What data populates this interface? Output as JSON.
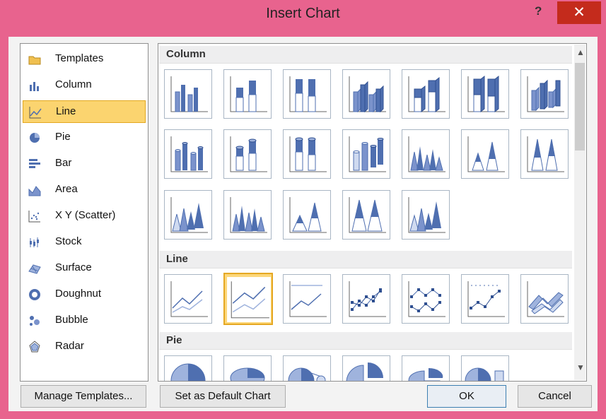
{
  "window": {
    "title": "Insert Chart",
    "help": "?",
    "close": "✕"
  },
  "categories": [
    {
      "label": "Templates",
      "icon": "folder-icon"
    },
    {
      "label": "Column",
      "icon": "column-chart-icon"
    },
    {
      "label": "Line",
      "icon": "line-chart-icon",
      "selected": true
    },
    {
      "label": "Pie",
      "icon": "pie-chart-icon"
    },
    {
      "label": "Bar",
      "icon": "bar-chart-icon"
    },
    {
      "label": "Area",
      "icon": "area-chart-icon"
    },
    {
      "label": "X Y (Scatter)",
      "icon": "scatter-chart-icon"
    },
    {
      "label": "Stock",
      "icon": "stock-chart-icon"
    },
    {
      "label": "Surface",
      "icon": "surface-chart-icon"
    },
    {
      "label": "Doughnut",
      "icon": "doughnut-chart-icon"
    },
    {
      "label": "Bubble",
      "icon": "bubble-chart-icon"
    },
    {
      "label": "Radar",
      "icon": "radar-chart-icon"
    }
  ],
  "sections": {
    "column": "Column",
    "line": "Line",
    "pie": "Pie"
  },
  "buttons": {
    "manage_templates": "Manage Templates...",
    "set_default": "Set as Default Chart",
    "ok": "OK",
    "cancel": "Cancel"
  },
  "colors": {
    "title_bar": "#e8638e",
    "close": "#c42b1c",
    "selection": "#fbd46f",
    "chart_blue": "#4f6fb0"
  }
}
